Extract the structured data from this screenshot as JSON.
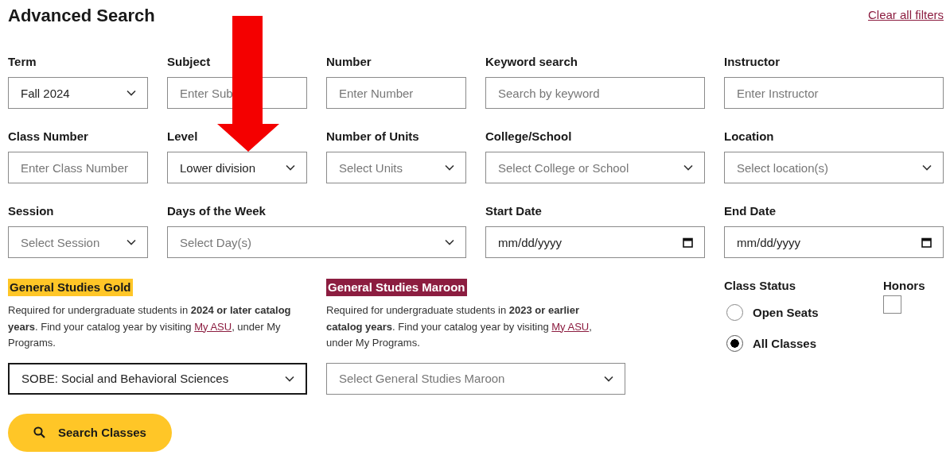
{
  "title": "Advanced Search",
  "clear_link": "Clear all filters",
  "fields": [
    {
      "kind": "select",
      "label": "Term",
      "value": "Fall 2024"
    },
    {
      "kind": "input",
      "label": "Subject",
      "placeholder": "Enter Sub"
    },
    {
      "kind": "input",
      "label": "Number",
      "placeholder": "Enter Number"
    },
    {
      "kind": "input",
      "label": "Keyword search",
      "placeholder": "Search by keyword"
    },
    {
      "kind": "input",
      "label": "Instructor",
      "placeholder": "Enter Instructor"
    },
    {
      "kind": "input",
      "label": "Class Number",
      "placeholder": "Enter Class Number"
    },
    {
      "kind": "select",
      "label": "Level",
      "value": "Lower division"
    },
    {
      "kind": "select",
      "label": "Number of Units",
      "placeholder": "Select Units"
    },
    {
      "kind": "select",
      "label": "College/School",
      "placeholder": "Select College or School"
    },
    {
      "kind": "select",
      "label": "Location",
      "placeholder": "Select location(s)"
    },
    {
      "kind": "select",
      "label": "Session",
      "placeholder": "Select Session"
    },
    {
      "kind": "wide_select",
      "label": "Days of the Week",
      "placeholder": "Select Day(s)"
    },
    {
      "kind": "date",
      "label": "Start Date",
      "value": "mm/dd/yyyy"
    },
    {
      "kind": "date",
      "label": "End Date",
      "value": "mm/dd/yyyy"
    }
  ],
  "general_studies": [
    {
      "kind": "gold",
      "heading": "General Studies Gold",
      "text_before": "Required for undergraduate students in **2024 or later catalog years**. Find your catalog year by visiting",
      "link": "My ASU",
      "text_after": ", under My Programs.",
      "select": {
        "value": "SOBE: Social and Behavioral Sciences",
        "focused": true
      }
    },
    {
      "kind": "maroon",
      "heading": "General Studies Maroon",
      "text_before": "Required for undergraduate students in **2023 or earlier catalog years**. Find your catalog year by visiting",
      "link": "My ASU",
      "text_after": ", under My Programs.",
      "select": {
        "placeholder": "Select General Studies Maroon",
        "focused": false
      }
    }
  ],
  "class_status": {
    "label": "Class Status",
    "options": [
      {
        "label": "Open Seats",
        "selected": false
      },
      {
        "label": "All Classes",
        "selected": true
      }
    ]
  },
  "honors": {
    "label": "Honors",
    "checked": false
  },
  "search_button": "Search Classes",
  "annotation": {
    "kind": "arrow"
  }
}
